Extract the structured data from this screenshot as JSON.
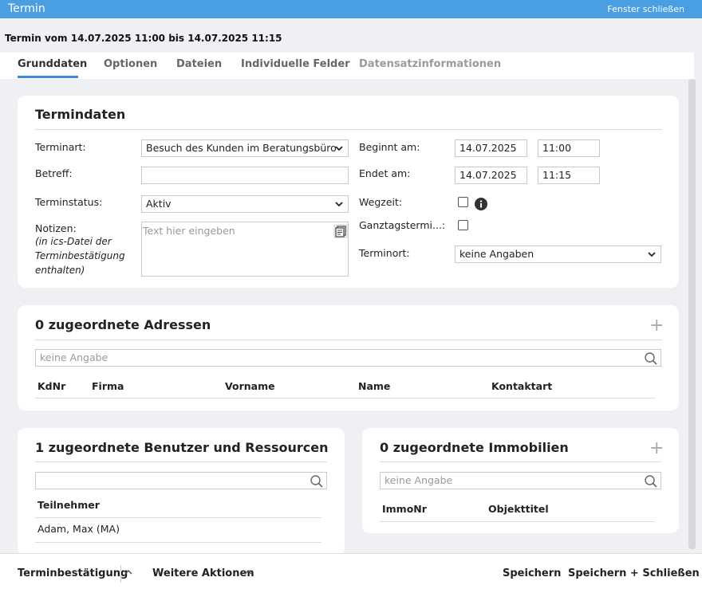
{
  "window": {
    "title": "Termin",
    "close_label": "Fenster schließen"
  },
  "header": {
    "subtitle": "Termin vom 14.07.2025 11:00 bis 14.07.2025 11:15"
  },
  "tabs": [
    {
      "label": "Grunddaten"
    },
    {
      "label": "Optionen"
    },
    {
      "label": "Dateien"
    },
    {
      "label": "Individuelle Felder"
    },
    {
      "label": "Datensatzinformationen"
    }
  ],
  "termindaten": {
    "title": "Termindaten",
    "terminart_label": "Terminart:",
    "terminart_value": "Besuch des Kunden im Beratungsbüro",
    "betreff_label": "Betreff:",
    "betreff_value": "",
    "status_label": "Terminstatus:",
    "status_value": "Aktiv",
    "notizen_label": "Notizen:",
    "notizen_hint": "(in ics-Datei der Terminbestätigung enthalten)",
    "notizen_placeholder": "Text hier eingeben",
    "beginnt_label": "Beginnt am:",
    "beginnt_date": "14.07.2025",
    "beginnt_time": "11:00",
    "endet_label": "Endet am:",
    "endet_date": "14.07.2025",
    "endet_time": "11:15",
    "wegzeit_label": "Wegzeit:",
    "ganztags_label": "Ganztagstermi...:",
    "terminort_label": "Terminort:",
    "terminort_value": "keine Angaben"
  },
  "adressen": {
    "title": "0 zugeordnete Adressen",
    "search_placeholder": "keine Angabe",
    "columns": [
      "KdNr",
      "Firma",
      "Vorname",
      "Name",
      "Kontaktart"
    ]
  },
  "benutzer": {
    "title": "1 zugeordnete Benutzer und Ressourcen",
    "search_placeholder": "",
    "column": "Teilnehmer",
    "rows": [
      "Adam, Max (MA)"
    ]
  },
  "immobilien": {
    "title": "0 zugeordnete Immobilien",
    "search_placeholder": "keine Angabe",
    "columns": [
      "ImmoNr",
      "Objekttitel"
    ]
  },
  "footer": {
    "confirm_label": "Terminbestätigung",
    "more_label": "Weitere Aktionen",
    "save_label": "Speichern",
    "save_close_label": "Speichern + Schließen"
  },
  "colors": {
    "titlebar": "#4a9fe2",
    "tab_active_underline": "#3a8ad6",
    "background": "#eef0f4"
  }
}
